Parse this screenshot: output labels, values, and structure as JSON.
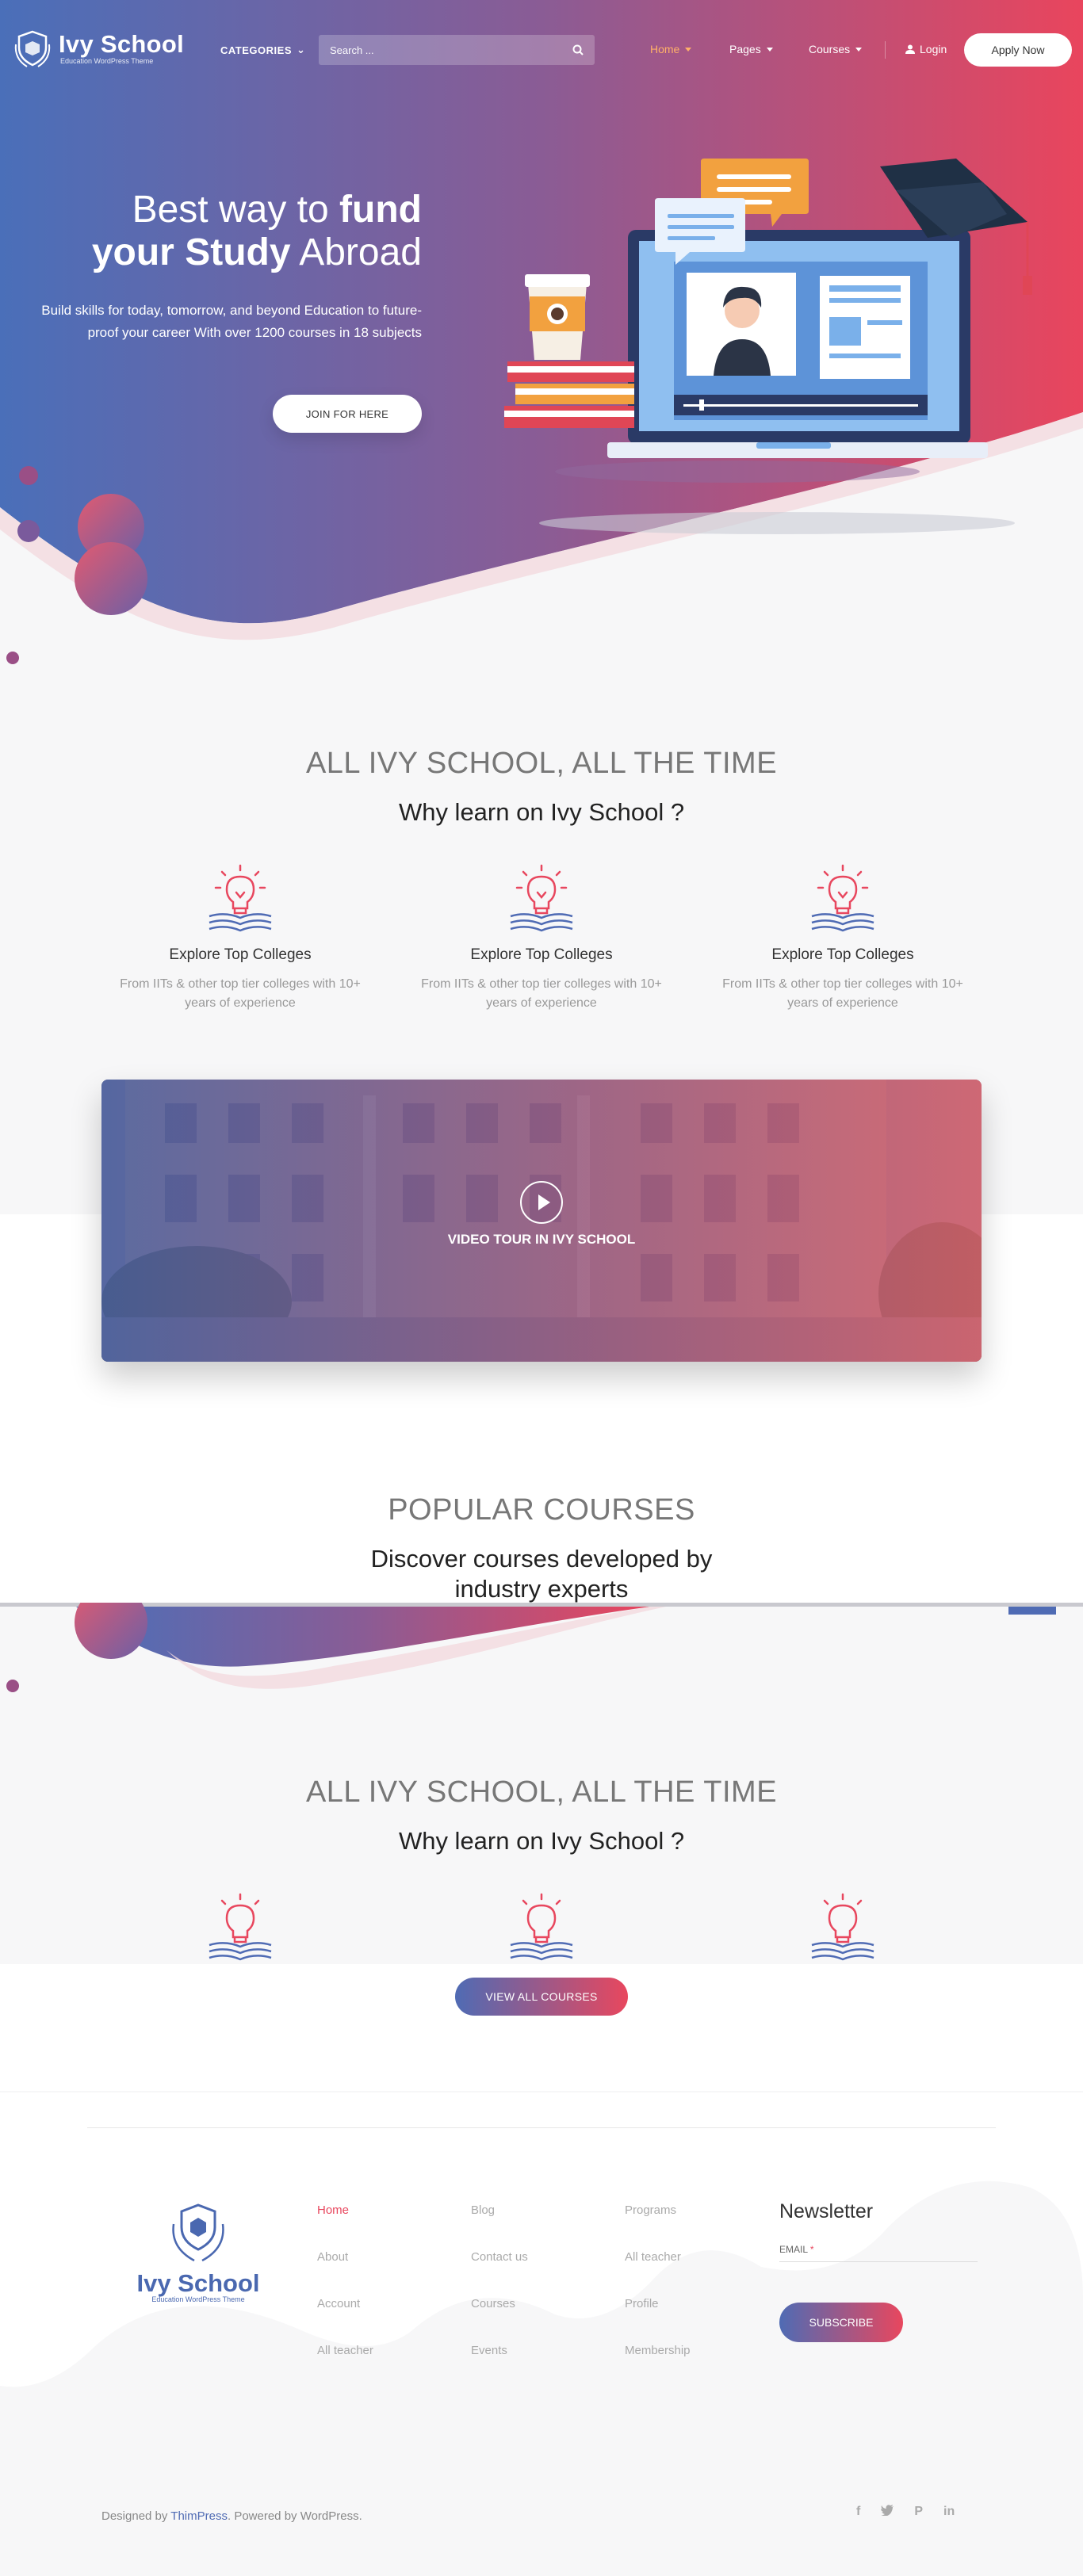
{
  "header": {
    "logo_name": "Ivy School",
    "logo_tagline": "Education WordPress Theme",
    "categories_label": "CATEGORIES",
    "search_placeholder": "Search ...",
    "nav": [
      {
        "label": "Home",
        "active": true
      },
      {
        "label": "Pages",
        "active": false
      },
      {
        "label": "Courses",
        "active": false
      }
    ],
    "login_label": "Login",
    "apply_label": "Apply Now"
  },
  "hero": {
    "title_light_1": "Best way to ",
    "title_bold_1": "fund",
    "title_bold_2": "your Study",
    "title_light_2": " Abroad",
    "description": "Build skills for today, tomorrow, and beyond Education to future-proof your career With over 1200 courses in 18 subjects",
    "cta_label": "JOIN FOR HERE"
  },
  "why": {
    "subtitle": "ALL IVY SCHOOL, ALL THE TIME",
    "title": "Why learn on Ivy School ?",
    "features": [
      {
        "title": "Explore Top Colleges",
        "text": "From IITs & other top tier colleges with 10+ years of experience"
      },
      {
        "title": "Explore Top Colleges",
        "text": "From IITs & other top tier colleges with 10+ years of experience"
      },
      {
        "title": "Explore Top Colleges",
        "text": "From IITs & other top tier colleges with 10+ years of experience"
      }
    ]
  },
  "video": {
    "caption": "VIDEO TOUR IN IVY SCHOOL"
  },
  "popular": {
    "subtitle": "POPULAR COURSES",
    "title": "Discover courses developed by industry experts"
  },
  "why2": {
    "subtitle": "ALL IVY SCHOOL, ALL THE TIME",
    "title": "Why learn on Ivy School ?"
  },
  "view_all_label": "VIEW ALL COURSES",
  "footer": {
    "logo_name": "Ivy School",
    "logo_tagline": "Education WordPress Theme",
    "col1": [
      "Home",
      "About",
      "Account",
      "All teacher"
    ],
    "col2": [
      "Blog",
      "Contact us",
      "Courses",
      "Events"
    ],
    "col3": [
      "Programs",
      "All teacher",
      "Profile",
      "Membership"
    ],
    "newsletter_title": "Newsletter",
    "email_label": "EMAIL",
    "required_mark": "*",
    "subscribe_label": "SUBSCRIBE",
    "copyright_pre": "Designed by ",
    "copyright_link": "ThimPress",
    "copyright_post": ". Powered by WordPress.",
    "social": [
      "facebook-icon",
      "twitter-icon",
      "pinterest-icon",
      "linkedin-icon"
    ]
  },
  "colors": {
    "brand_blue": "#4f6bb4",
    "brand_red": "#e8475e",
    "active_nav": "#ffb068"
  }
}
